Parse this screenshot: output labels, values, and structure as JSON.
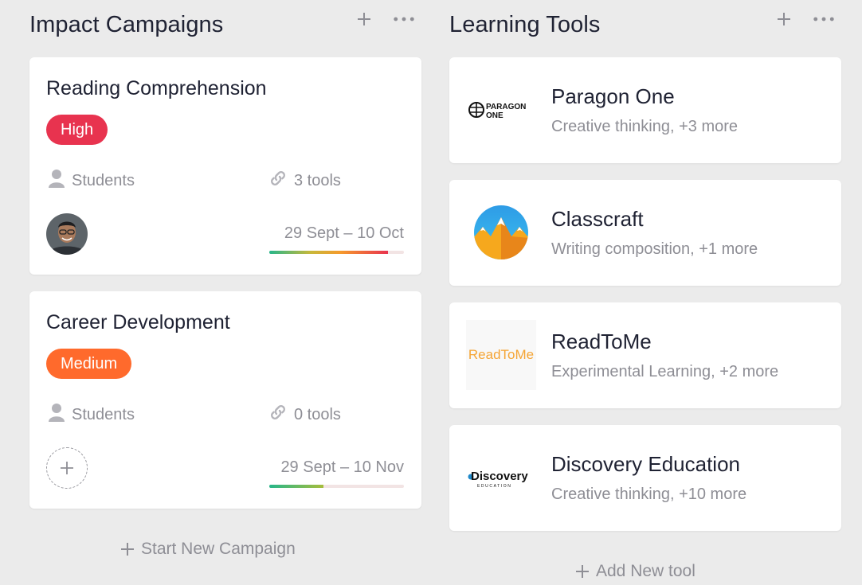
{
  "campaigns_column": {
    "title": "Impact Campaigns",
    "add_icon": "plus-icon",
    "more_icon": "ellipsis-icon",
    "cards": [
      {
        "title": "Reading Comprehension",
        "priority": "High",
        "priority_color": "#e8334f",
        "audience": "Students",
        "tools": "3 tools",
        "date_range": "29 Sept – 10 Oct",
        "progress": 0.88,
        "has_avatar": true
      },
      {
        "title": "Career Development",
        "priority": "Medium",
        "priority_color": "#ff6a2c",
        "audience": "Students",
        "tools": "0 tools",
        "date_range": "29 Sept – 10 Nov",
        "progress": 0.4,
        "has_avatar": false
      }
    ],
    "add_label": "Start New Campaign"
  },
  "tools_column": {
    "title": "Learning Tools",
    "add_icon": "plus-icon",
    "more_icon": "ellipsis-icon",
    "tools": [
      {
        "name": "Paragon One",
        "subtitle": "Creative thinking, +3 more",
        "logo": "paragon-one-logo",
        "logo_text": [
          "PARAGON",
          "ONE"
        ]
      },
      {
        "name": "Classcraft",
        "subtitle": "Writing composition, +1 more",
        "logo": "classcraft-logo"
      },
      {
        "name": "ReadToMe",
        "subtitle": "Experimental Learning, +2 more",
        "logo": "readtome-logo",
        "logo_text": "ReadToMe",
        "logo_color": "#f5a535"
      },
      {
        "name": "Discovery Education",
        "subtitle": "Creative thinking, +10 more",
        "logo": "discovery-education-logo",
        "logo_text": [
          "Discovery",
          "EDUCATION"
        ]
      }
    ],
    "add_label": "Add New tool"
  }
}
